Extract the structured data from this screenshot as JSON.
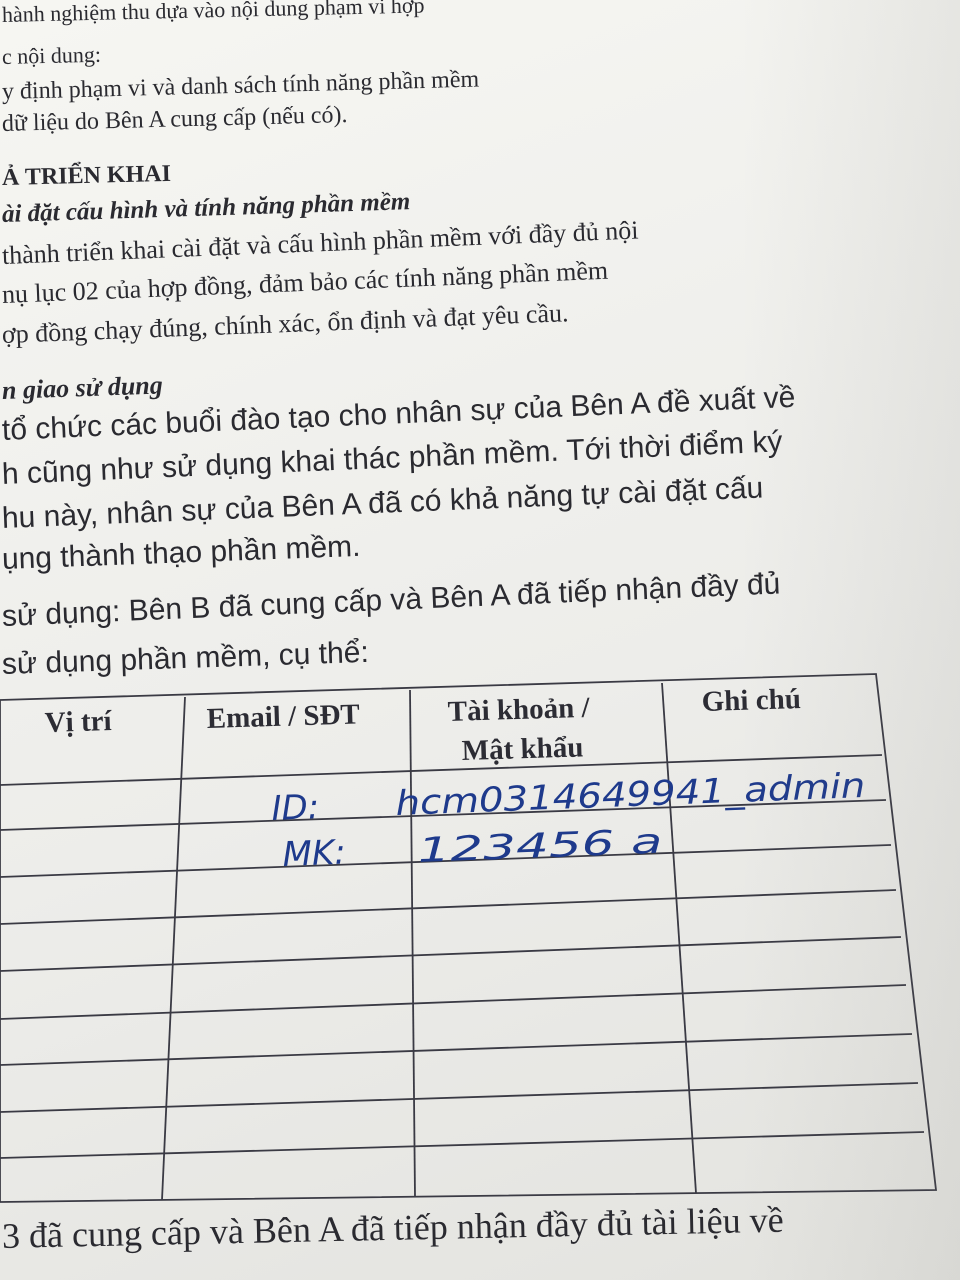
{
  "text_lines": {
    "l1": "hành nghiệm thu dựa vào nội dung phạm vi hợp",
    "l2": "c nội dung:",
    "l3": "y định phạm vi và danh sách tính năng phần mềm",
    "l4": "dữ liệu do Bên A cung cấp (nếu có).",
    "h1": "Ả TRIỂN KHAI",
    "h2": "ài đặt cấu hình và tính năng phần mềm",
    "l5": "thành triển khai cài đặt và cấu hình phần mềm với đầy đủ nội",
    "l6": "nụ lục 02 của hợp đồng, đảm bảo các tính năng phần mềm",
    "l7": "ợp đồng chạy đúng, chính xác, ổn định và đạt yêu cầu.",
    "h3": "n giao sử dụng",
    "l8": " tổ chức các buổi đào tạo cho nhân sự của Bên A đề xuất về",
    "l9": "h cũng như sử dụng khai thác phần mềm. Tới thời điểm ký",
    "l10": "hu này, nhân sự của Bên A đã có khả năng tự cài đặt cấu",
    "l11": "ụng thành thạo phần mềm.",
    "l12": "sử dụng: Bên B đã cung cấp và Bên A đã tiếp nhận đầy đủ",
    "l13": "sử dụng phần mềm,  cụ thể:",
    "l14": "3 đã cung cấp và Bên A đã tiếp nhận đầy đủ tài liệu về"
  },
  "table": {
    "headers": {
      "position": "Vị trí",
      "email_phone": "Email / SĐT",
      "account_line1": "Tài khoản /",
      "account_line2": "Mật khẩu",
      "notes": "Ghi chú"
    },
    "handwriting": {
      "id_label": "ID:",
      "id_value": "hcm0314649941_admin",
      "mk_label": "MK:",
      "mk_value": "123456 a"
    }
  },
  "colors": {
    "ink_blue": "#1e3a8c",
    "print": "#2a2a30"
  }
}
